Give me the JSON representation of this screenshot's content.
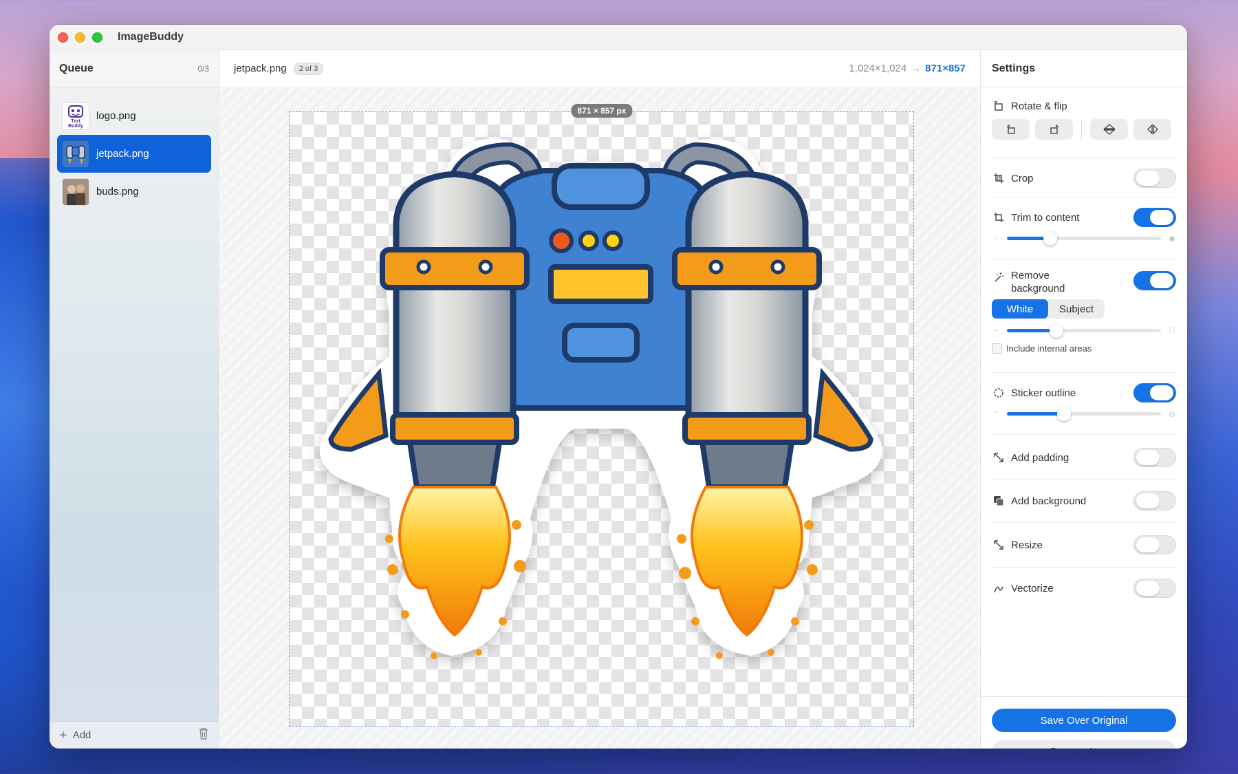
{
  "window": {
    "app_title": "ImageBuddy"
  },
  "sidebar": {
    "title": "Queue",
    "count": "0/3",
    "items": [
      {
        "label": "logo.png",
        "thumb_text": "Text Buddy"
      },
      {
        "label": "jetpack.png",
        "selected": true
      },
      {
        "label": "buds.png"
      }
    ],
    "add_label": "Add"
  },
  "editor": {
    "file_name": "jetpack.png",
    "position_badge": "2 of 3",
    "original_dims": "1,024×1,024",
    "new_dims": "871×857",
    "size_tag": "871 × 857 px"
  },
  "settings": {
    "title": "Settings",
    "rotate_flip_label": "Rotate & flip",
    "crop_label": "Crop",
    "crop_on": false,
    "trim_label": "Trim to content",
    "trim_on": true,
    "trim_level": 0.28,
    "remove_bg_label": "Remove background",
    "remove_bg_on": true,
    "remove_bg_mode_white": "White",
    "remove_bg_mode_subject": "Subject",
    "remove_bg_selected": "White",
    "remove_bg_level": 0.32,
    "include_internal_label": "Include internal areas",
    "include_internal_checked": false,
    "sticker_label": "Sticker outline",
    "sticker_on": true,
    "sticker_level": 0.37,
    "padding_label": "Add padding",
    "padding_on": false,
    "background_label": "Add background",
    "background_on": false,
    "resize_label": "Resize",
    "resize_on": false,
    "vectorize_label": "Vectorize",
    "vectorize_on": false,
    "save_over_label": "Save Over Original",
    "save_new_label": "Save as New..."
  },
  "colors": {
    "accent": "#1673e6",
    "selected_row": "#0f62da"
  }
}
